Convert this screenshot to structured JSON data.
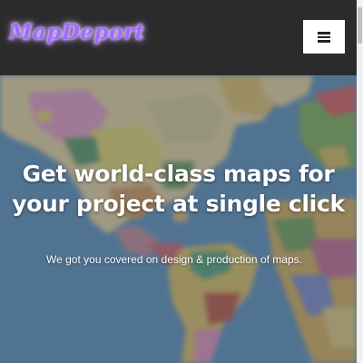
{
  "header": {
    "logo_text": "MapDeport",
    "menu_icon": "hamburger-menu-icon"
  },
  "hero": {
    "title": "Get world-class maps for your project at single click",
    "subtitle": "We got you covered on design & production of maps."
  },
  "colors": {
    "header_bg": "#2b2b2b",
    "logo": "#a06bff",
    "ocean": "#6e9fc0",
    "menu_button_bg": "#ffffff"
  }
}
